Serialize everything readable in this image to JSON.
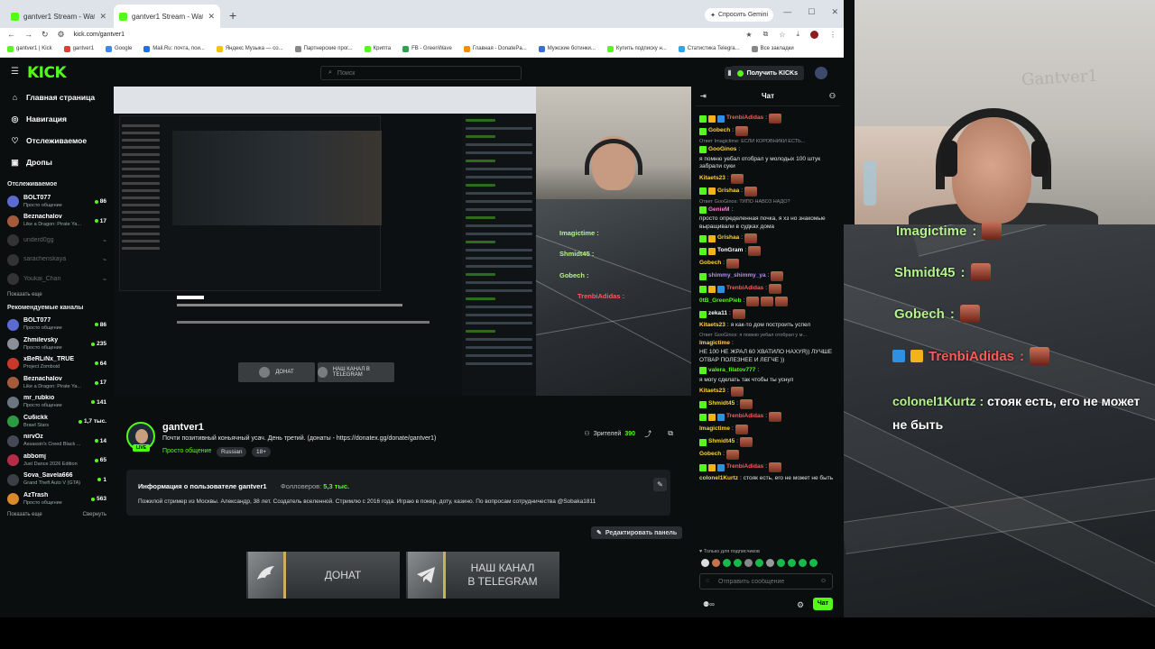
{
  "browser": {
    "tabs": [
      {
        "title": "gantver1 Stream - Watch Live o"
      },
      {
        "title": "gantver1 Stream - Watch Live o"
      }
    ],
    "new_tab": "+",
    "gemini_label": "Спросить Gemini",
    "url": "kick.com/gantver1",
    "bookmarks": [
      "gantver1 | Kick",
      "gantver1",
      "Google",
      "Mail.Ru: почта, пои...",
      "Яндекс Музыка — со...",
      "Партнерские прог...",
      "Крипта",
      "FB - GreenWave",
      "Главная - DonatePa...",
      "Мужские ботинки...",
      "Купить подписку н...",
      "Статистика Telegra...",
      "Все закладки"
    ]
  },
  "kick": {
    "logo": "KICK",
    "search_placeholder": "Поиск",
    "cta": "Получить KICKs"
  },
  "sidebar": {
    "nav": [
      {
        "label": "Главная страница",
        "icon": "home-icon"
      },
      {
        "label": "Навигация",
        "icon": "compass-icon"
      },
      {
        "label": "Отслеживаемое",
        "icon": "heart-icon"
      },
      {
        "label": "Дропы",
        "icon": "drops-icon"
      }
    ],
    "following_heading": "Отслеживаемое",
    "following": [
      {
        "name": "BOLT077",
        "sub": "Просто общение",
        "viewers": "86",
        "color": "#5b6bd1",
        "online": true
      },
      {
        "name": "Beznachalov",
        "sub": "Like a Dragon: Pirate Ya...",
        "viewers": "17",
        "color": "#a35b3c",
        "online": true
      },
      {
        "name": "underd0gg",
        "sub": "",
        "viewers": "",
        "color": "#333",
        "online": false
      },
      {
        "name": "sarachenskaya",
        "sub": "",
        "viewers": "",
        "color": "#333",
        "online": false
      },
      {
        "name": "Youkai_Chan",
        "sub": "",
        "viewers": "",
        "color": "#333",
        "online": false
      }
    ],
    "show_more": "Показать еще",
    "recommended_heading": "Рекомендуемые каналы",
    "recommended": [
      {
        "name": "BOLT077",
        "sub": "Просто общение",
        "viewers": "86",
        "color": "#5b6bd1"
      },
      {
        "name": "Zhmilevsky",
        "sub": "Просто общение",
        "viewers": "235",
        "color": "#8a8f99"
      },
      {
        "name": "xBeRLiNx_TRUE",
        "sub": "Project Zomboid",
        "viewers": "64",
        "color": "#c9392b"
      },
      {
        "name": "Beznachalov",
        "sub": "Like a Dragon: Pirate Ya...",
        "viewers": "17",
        "color": "#a35b3c"
      },
      {
        "name": "mr_rubkio",
        "sub": "Просто общение",
        "viewers": "141",
        "color": "#6b7480"
      },
      {
        "name": "Cu6ickk",
        "sub": "Brawl Stars",
        "viewers": "1,7 тыс.",
        "color": "#2e9b43"
      },
      {
        "name": "nirvOz",
        "sub": "Assassin's Creed Black ...",
        "viewers": "14",
        "color": "#444a55"
      },
      {
        "name": "abbomj",
        "sub": "Just Dance 2026 Edition",
        "viewers": "65",
        "color": "#b32d4a"
      },
      {
        "name": "Sova_Savela666",
        "sub": "Grand Theft Auto V (GTA)",
        "viewers": "1",
        "color": "#3b3f46"
      },
      {
        "name": "AzTrash",
        "sub": "Просто общение",
        "viewers": "563",
        "color": "#d98a2b"
      }
    ],
    "collapse": "Свернуть"
  },
  "player": {
    "overlay_names": [
      "Imagictime :",
      "Shmidt45 :",
      "Gobech :",
      "TrenbiAdidas :"
    ],
    "donate_label": "ДОНАТ",
    "tg_label": "НАШ КАНАЛ В TELEGRAM"
  },
  "stream": {
    "name": "gantver1",
    "live": "LIVE",
    "title": "Почти позитивный коньячный усач. День третий. (донаты - https://donatex.gg/donate/gantver1)",
    "category": "Просто общение",
    "tags": [
      "Russian",
      "18+"
    ],
    "viewers_label": "Зрителей",
    "viewers": "390"
  },
  "about": {
    "heading": "Информация о пользователе gantver1",
    "followers_label": "Фолловеров:",
    "followers": "5,3 тыс.",
    "text": "Пожилой стример из Москвы. Александр, 38 лет. Создатель вселенной. Стримлю с 2016 года. Играю в покер, доту, казино. По вопросам сотрудничества @Sobaka1811",
    "edit_panel": "Редактировать панель"
  },
  "buttons": {
    "donate": "ДОНАТ",
    "telegram_line1": "НАШ КАНАЛ",
    "telegram_line2": "В TELEGRAM"
  },
  "chat": {
    "title": "Чат",
    "messages": [
      {
        "reply": "",
        "user": "TrenbiAdidas",
        "color": "#ff5a5a",
        "text": "",
        "badges": 3,
        "emotes": 1
      },
      {
        "reply": "",
        "user": "Gobech",
        "color": "#ffd23f",
        "text": "",
        "badges": 1,
        "emotes": 1
      },
      {
        "reply": "Ответ Imagictime: ЕСЛИ КОРОВНИКИ ЕСТЬ...",
        "user": "GooGinos",
        "color": "#ffd23f",
        "text": "я помню уебал отобрал у молодых 100 штук забрали суки",
        "badges": 1,
        "emotes": 0
      },
      {
        "reply": "",
        "user": "Kitaets23",
        "color": "#ffd23f",
        "text": "",
        "badges": 0,
        "emotes": 1
      },
      {
        "reply": "",
        "user": "Grishaa",
        "color": "#ffd23f",
        "text": "",
        "badges": 2,
        "emotes": 1
      },
      {
        "reply": "Ответ GooGinos: ТИПО НАВОЗ НАДО?",
        "user": "GenieM",
        "color": "#ff7ad9",
        "text": "просто определенная почка, я хз но знакомые выращивали в судках дома",
        "badges": 1,
        "emotes": 0
      },
      {
        "reply": "",
        "user": "Grishaa",
        "color": "#ffd23f",
        "text": "",
        "badges": 2,
        "emotes": 1
      },
      {
        "reply": "",
        "user": "TonGram",
        "color": "#ffffff",
        "text": "",
        "badges": 2,
        "emotes": 1
      },
      {
        "reply": "",
        "user": "Gobech",
        "color": "#ffd23f",
        "text": "",
        "badges": 0,
        "emotes": 1
      },
      {
        "reply": "",
        "user": "shimmy_shimmy_ya",
        "color": "#b18cff",
        "text": "",
        "badges": 1,
        "emotes": 1
      },
      {
        "reply": "",
        "user": "TrenbiAdidas",
        "color": "#ff5a5a",
        "text": "",
        "badges": 3,
        "emotes": 1
      },
      {
        "reply": "",
        "user": "0tB_GreenPieb",
        "color": "#53fc18",
        "text": "",
        "badges": 0,
        "emotes": 3
      },
      {
        "reply": "",
        "user": "zeka11",
        "color": "#ffffff",
        "text": "",
        "badges": 1,
        "emotes": 1
      },
      {
        "reply": "",
        "user": "Kitaets23",
        "color": "#ffd23f",
        "text": "я как-то дом построить успел",
        "badges": 0,
        "emotes": 0
      },
      {
        "reply": "Ответ GooGinos: я помню уебал отобрал у м...",
        "user": "Imagictime",
        "color": "#ffd23f",
        "text": "НЕ 100 НЕ ЖРАЛ 60 ХВАТИЛО НАХУЯ)) ЛУЧШЕ ОТВАР ПОЛЕЗНЕЕ И ЛЕГЧЕ ))",
        "badges": 0,
        "emotes": 0
      },
      {
        "reply": "",
        "user": "valera_filatov777",
        "color": "#53fc18",
        "text": "я могу сделать так чтобы ты уснул",
        "badges": 1,
        "emotes": 0
      },
      {
        "reply": "",
        "user": "Kitaets23",
        "color": "#ffd23f",
        "text": "",
        "badges": 0,
        "emotes": 1
      },
      {
        "reply": "",
        "user": "Shmidt45",
        "color": "#ffd23f",
        "text": "",
        "badges": 1,
        "emotes": 1
      },
      {
        "reply": "",
        "user": "TrenbiAdidas",
        "color": "#ff5a5a",
        "text": "",
        "badges": 3,
        "emotes": 1
      },
      {
        "reply": "",
        "user": "Imagictime",
        "color": "#ffd23f",
        "text": "",
        "badges": 0,
        "emotes": 1
      },
      {
        "reply": "",
        "user": "Shmidt45",
        "color": "#ffd23f",
        "text": "",
        "badges": 1,
        "emotes": 1
      },
      {
        "reply": "",
        "user": "Gobech",
        "color": "#ffd23f",
        "text": "",
        "badges": 0,
        "emotes": 1
      },
      {
        "reply": "",
        "user": "TrenbiAdidas",
        "color": "#ff5a5a",
        "text": "",
        "badges": 3,
        "emotes": 1
      },
      {
        "reply": "",
        "user": "colonel1Kurtz",
        "color": "#ffd23f",
        "text": "стояк есть, его не может не быть",
        "badges": 0,
        "emotes": 0
      }
    ],
    "sub_only": "Только для подписчиков",
    "input_placeholder": "Отправить сообщение",
    "send": "Чат"
  },
  "overlay": {
    "names": [
      {
        "user": "Imagictime",
        "color": "#b5f28c"
      },
      {
        "user": "Shmidt45",
        "color": "#b5f28c"
      },
      {
        "user": "Gobech",
        "color": "#b5f28c"
      },
      {
        "user": "TrenbiAdidas",
        "color": "#ff5a5a"
      }
    ],
    "message_user": "colonel1Kurtz :",
    "message_text": "стояк есть, его не может не быть",
    "webcam_text": "Gantver1"
  },
  "colors": {
    "accent": "#53fc18"
  }
}
